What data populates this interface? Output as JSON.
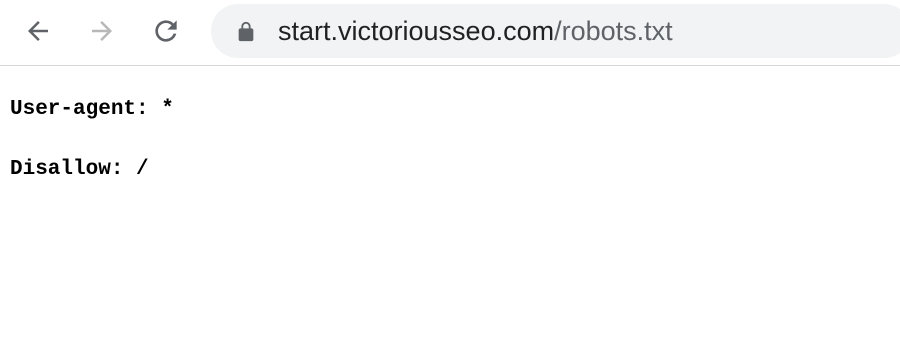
{
  "browser": {
    "url_host": "start.victoriousseo.com",
    "url_path": "/robots.txt",
    "icons": {
      "back": "back-arrow-icon",
      "forward": "forward-arrow-icon",
      "reload": "reload-icon",
      "lock": "lock-icon"
    },
    "colors": {
      "icon_active": "#5f6368",
      "icon_disabled": "#b8b8b8",
      "omnibox_bg": "#f1f3f4"
    }
  },
  "page": {
    "lines": [
      "User-agent: *",
      "Disallow: /"
    ]
  }
}
